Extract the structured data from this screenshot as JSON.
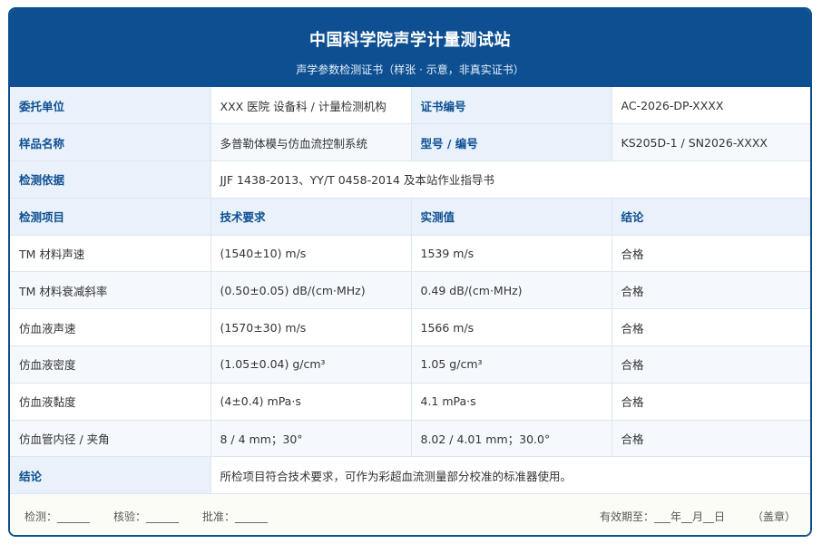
{
  "header": {
    "title": "中国科学院声学计量测试站",
    "subtitle": "声学参数检测证书（样张 · 示意，非真实证书）"
  },
  "info": {
    "client_label": "委托单位",
    "client_value": "XXX 医院 设备科 / 计量检测机构",
    "cert_no_label": "证书编号",
    "cert_no_value": "AC-2026-DP-XXXX",
    "sample_label": "样品名称",
    "sample_value": "多普勒体模与仿血流控制系统",
    "model_label": "型号 / 编号",
    "model_value": "KS205D-1 / SN2026-XXXX",
    "basis_label": "检测依据",
    "basis_value": "JJF 1438-2013、YY/T 0458-2014 及本站作业指导书"
  },
  "table": {
    "headers": [
      "检测项目",
      "技术要求",
      "实测值",
      "结论"
    ],
    "rows": [
      {
        "item": "TM 材料声速",
        "req": "(1540±10) m/s",
        "meas": "1539 m/s",
        "result": "合格"
      },
      {
        "item": "TM 材料衰减斜率",
        "req": "(0.50±0.05) dB/(cm·MHz)",
        "meas": "0.49 dB/(cm·MHz)",
        "result": "合格"
      },
      {
        "item": "仿血液声速",
        "req": "(1570±30) m/s",
        "meas": "1566 m/s",
        "result": "合格"
      },
      {
        "item": "仿血液密度",
        "req": "(1.05±0.04) g/cm³",
        "meas": "1.05 g/cm³",
        "result": "合格"
      },
      {
        "item": "仿血液黏度",
        "req": "(4±0.4) mPa·s",
        "meas": "4.1 mPa·s",
        "result": "合格"
      },
      {
        "item": "仿血管内径 / 夹角",
        "req": "8 / 4 mm；30°",
        "meas": "8.02 / 4.01 mm；30.0°",
        "result": "合格"
      }
    ]
  },
  "conclusion": {
    "label": "结论",
    "value": "所检项目符合技术要求，可作为彩超血流测量部分校准的标准器使用。"
  },
  "footer": {
    "tested": "检测：______",
    "checked": "核验：______",
    "approved": "批准：______",
    "valid": "有效期至：___年__月__日",
    "seal": "（盖章）"
  },
  "colors": {
    "brand": "#0d4f91",
    "label_bg": "#e9f1fb"
  }
}
